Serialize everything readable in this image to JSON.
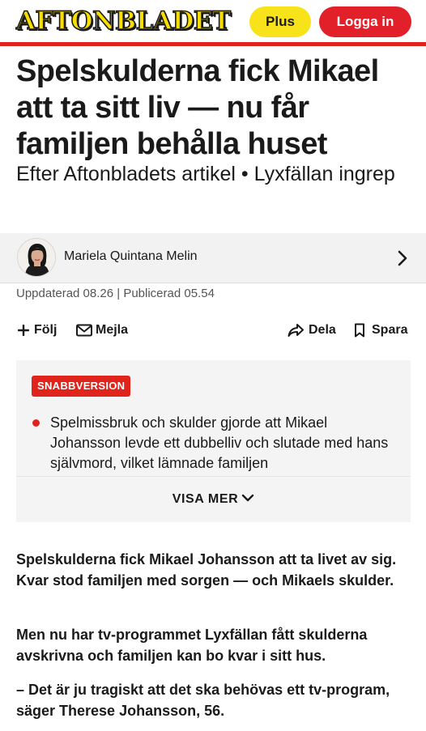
{
  "header": {
    "logo_text": "AFTONBLADET",
    "plus_label": "Plus",
    "login_label": "Logga in",
    "colors": {
      "brand_red": "#e1241b",
      "plus_yellow": "#f8e21a",
      "logo_yellow": "#f7dd00"
    }
  },
  "article": {
    "headline": "Spelskulderna fick Mikael att ta sitt liv — nu får familjen behålla huset",
    "subheadline": "Efter Aftonbladets artikel • Lyxfällan ingrep",
    "author": {
      "name": "Mariela Quintana Melin"
    },
    "dates": "Uppdaterad 08.26 | Publicerad 05.54",
    "actions": {
      "follow": "Följ",
      "email": "Mejla",
      "share": "Dela",
      "save": "Spara"
    },
    "summary": {
      "badge": "SNABBVERSION",
      "bullet": "Spelmissbruk och skulder gjorde att Mikael Johansson levde ett dubbelliv och slutade med hans självmord, vilket lämnade familjen",
      "show_more": "VISA MER"
    },
    "paragraphs": [
      "Spelskulderna fick Mikael Johansson att ta livet av sig. Kvar stod familjen med sorgen — och Mikaels skulder.",
      "Men nu har tv-programmet Lyxfällan fått skulderna avskrivna och familjen kan bo kvar i sitt hus.",
      "– Det är ju tragiskt att det ska behövas ett tv-program, säger Therese Johansson, 56."
    ]
  }
}
